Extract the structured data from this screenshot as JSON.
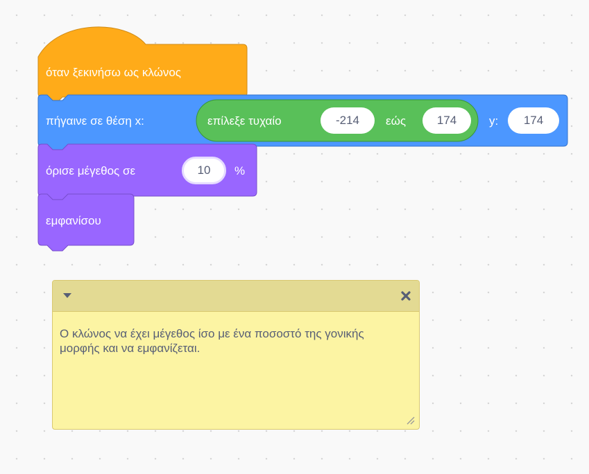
{
  "blocks": {
    "hat": {
      "label": "όταν ξεκινήσω ως κλώνος"
    },
    "goto": {
      "label": "πήγαινε σε θέση x:",
      "random": {
        "label": "επίλεξε τυχαίο",
        "from": "-214",
        "to_label": "εώς",
        "to": "174"
      },
      "y_label": "y:",
      "y": "174"
    },
    "size": {
      "label": "όρισε μέγεθος σε",
      "value": "10",
      "suffix": "%"
    },
    "show": {
      "label": "εμφανίσου"
    }
  },
  "comment": {
    "text": "Ο κλώνος να έχει μέγεθος ίσο με ένα ποσοστό της γονικής μορφής και να εμφανίζεται."
  },
  "colors": {
    "control": "#ffab19",
    "motion": "#4c97ff",
    "operators": "#59c059",
    "looks": "#9966ff",
    "comment": "#fcf4a3",
    "comment_header": "#e3da93"
  }
}
